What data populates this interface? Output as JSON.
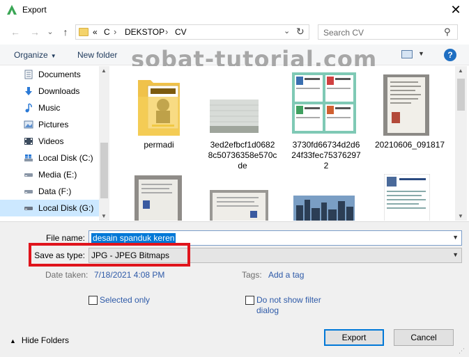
{
  "window": {
    "title": "Export",
    "close_glyph": "✕"
  },
  "nav": {
    "back_glyph": "←",
    "forward_glyph": "→",
    "dropdown_glyph": "⌄",
    "up_glyph": "↑",
    "breadcrumbs": [
      "«",
      "C",
      "DEKSTOP",
      "CV"
    ],
    "separator": "›",
    "address_dropdown_glyph": "⌄",
    "refresh_glyph": "↻",
    "search_placeholder": "Search CV",
    "search_glyph": "⚲"
  },
  "toolbar": {
    "organize_label": "Organize",
    "new_folder_label": "New folder",
    "help_glyph": "?",
    "caret_glyph": "▼"
  },
  "watermark": "sobat-tutorial.com",
  "sidebar": {
    "items": [
      {
        "label": "Documents",
        "icon": "documents-icon"
      },
      {
        "label": "Downloads",
        "icon": "downloads-icon"
      },
      {
        "label": "Music",
        "icon": "music-icon"
      },
      {
        "label": "Pictures",
        "icon": "pictures-icon"
      },
      {
        "label": "Videos",
        "icon": "videos-icon"
      },
      {
        "label": "Local Disk (C:)",
        "icon": "drive-icon"
      },
      {
        "label": "Media (E:)",
        "icon": "drive-icon"
      },
      {
        "label": "Data (F:)",
        "icon": "drive-icon"
      },
      {
        "label": "Local Disk (G:)",
        "icon": "drive-icon"
      }
    ],
    "selected_index": 8
  },
  "files": [
    {
      "label": "permadi",
      "kind": "folder"
    },
    {
      "label": "3ed2efbcf1d0682\n8c50736358e570c\nde",
      "kind": "image"
    },
    {
      "label": "3730fd66734d2d6\n24f33fec75376297\n2",
      "kind": "image"
    },
    {
      "label": "20210606_091817",
      "kind": "image"
    },
    {
      "label": "",
      "kind": "image"
    },
    {
      "label": "",
      "kind": "image"
    },
    {
      "label": "",
      "kind": "image"
    },
    {
      "label": "",
      "kind": "image"
    }
  ],
  "form": {
    "file_name_label": "File name:",
    "file_name_value": "desain spanduk keren",
    "save_type_label": "Save as type:",
    "save_type_value": "JPG - JPEG Bitmaps",
    "date_taken_label": "Date taken:",
    "date_taken_value": "7/18/2021 4:08 PM",
    "tags_label": "Tags:",
    "tags_value": "Add a tag",
    "selected_only_label": "Selected only",
    "no_filter_label": "Do not show filter\ndialog",
    "hide_folders_label": "Hide Folders",
    "export_label": "Export",
    "cancel_label": "Cancel"
  },
  "colors": {
    "highlight": "#e0141c",
    "selection": "#0078d7",
    "link": "#2e5aa8"
  }
}
